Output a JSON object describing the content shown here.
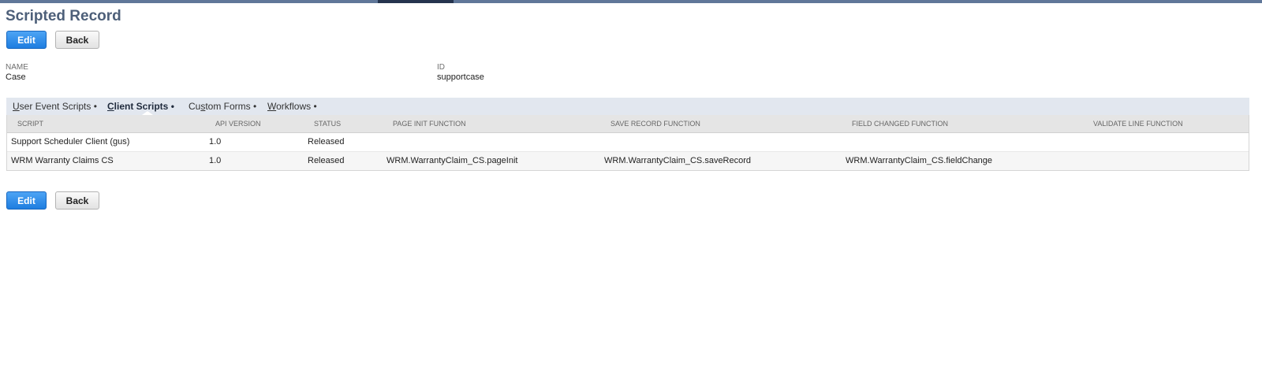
{
  "page": {
    "title": "Scripted Record"
  },
  "actions_top": {
    "edit_label": "Edit",
    "back_label": "Back"
  },
  "actions_bottom": {
    "edit_label": "Edit",
    "back_label": "Back"
  },
  "fields": {
    "name_label": "NAME",
    "name_value": "Case",
    "id_label": "ID",
    "id_value": "supportcase"
  },
  "tabs": [
    {
      "key": "U",
      "rest": "ser Event Scripts",
      "bullet": " •"
    },
    {
      "key": "C",
      "rest": "lient Scripts",
      "bullet": " •"
    },
    {
      "pre": "Cu",
      "key": "s",
      "rest": "tom Forms",
      "bullet": " •"
    },
    {
      "key": "W",
      "rest": "orkflows",
      "bullet": " •"
    }
  ],
  "active_tab": "Client Scripts",
  "table": {
    "headers": [
      "SCRIPT",
      "API VERSION",
      "STATUS",
      "PAGE INIT FUNCTION",
      "SAVE RECORD FUNCTION",
      "FIELD CHANGED FUNCTION",
      "VALIDATE LINE FUNCTION"
    ],
    "rows": [
      [
        "Support Scheduler Client (gus)",
        "1.0",
        "Released",
        "",
        "",
        "",
        ""
      ],
      [
        "WRM Warranty Claims CS",
        "1.0",
        "Released",
        "WRM.WarrantyClaim_CS.pageInit",
        "WRM.WarrantyClaim_CS.saveRecord",
        "WRM.WarrantyClaim_CS.fieldChange",
        ""
      ]
    ]
  },
  "colors": {
    "topbar": "#607799",
    "topbar_active": "#25344e",
    "title": "#4d5f79",
    "primary_button": "#1e7de0",
    "tabs_background": "#e2e7ef"
  }
}
